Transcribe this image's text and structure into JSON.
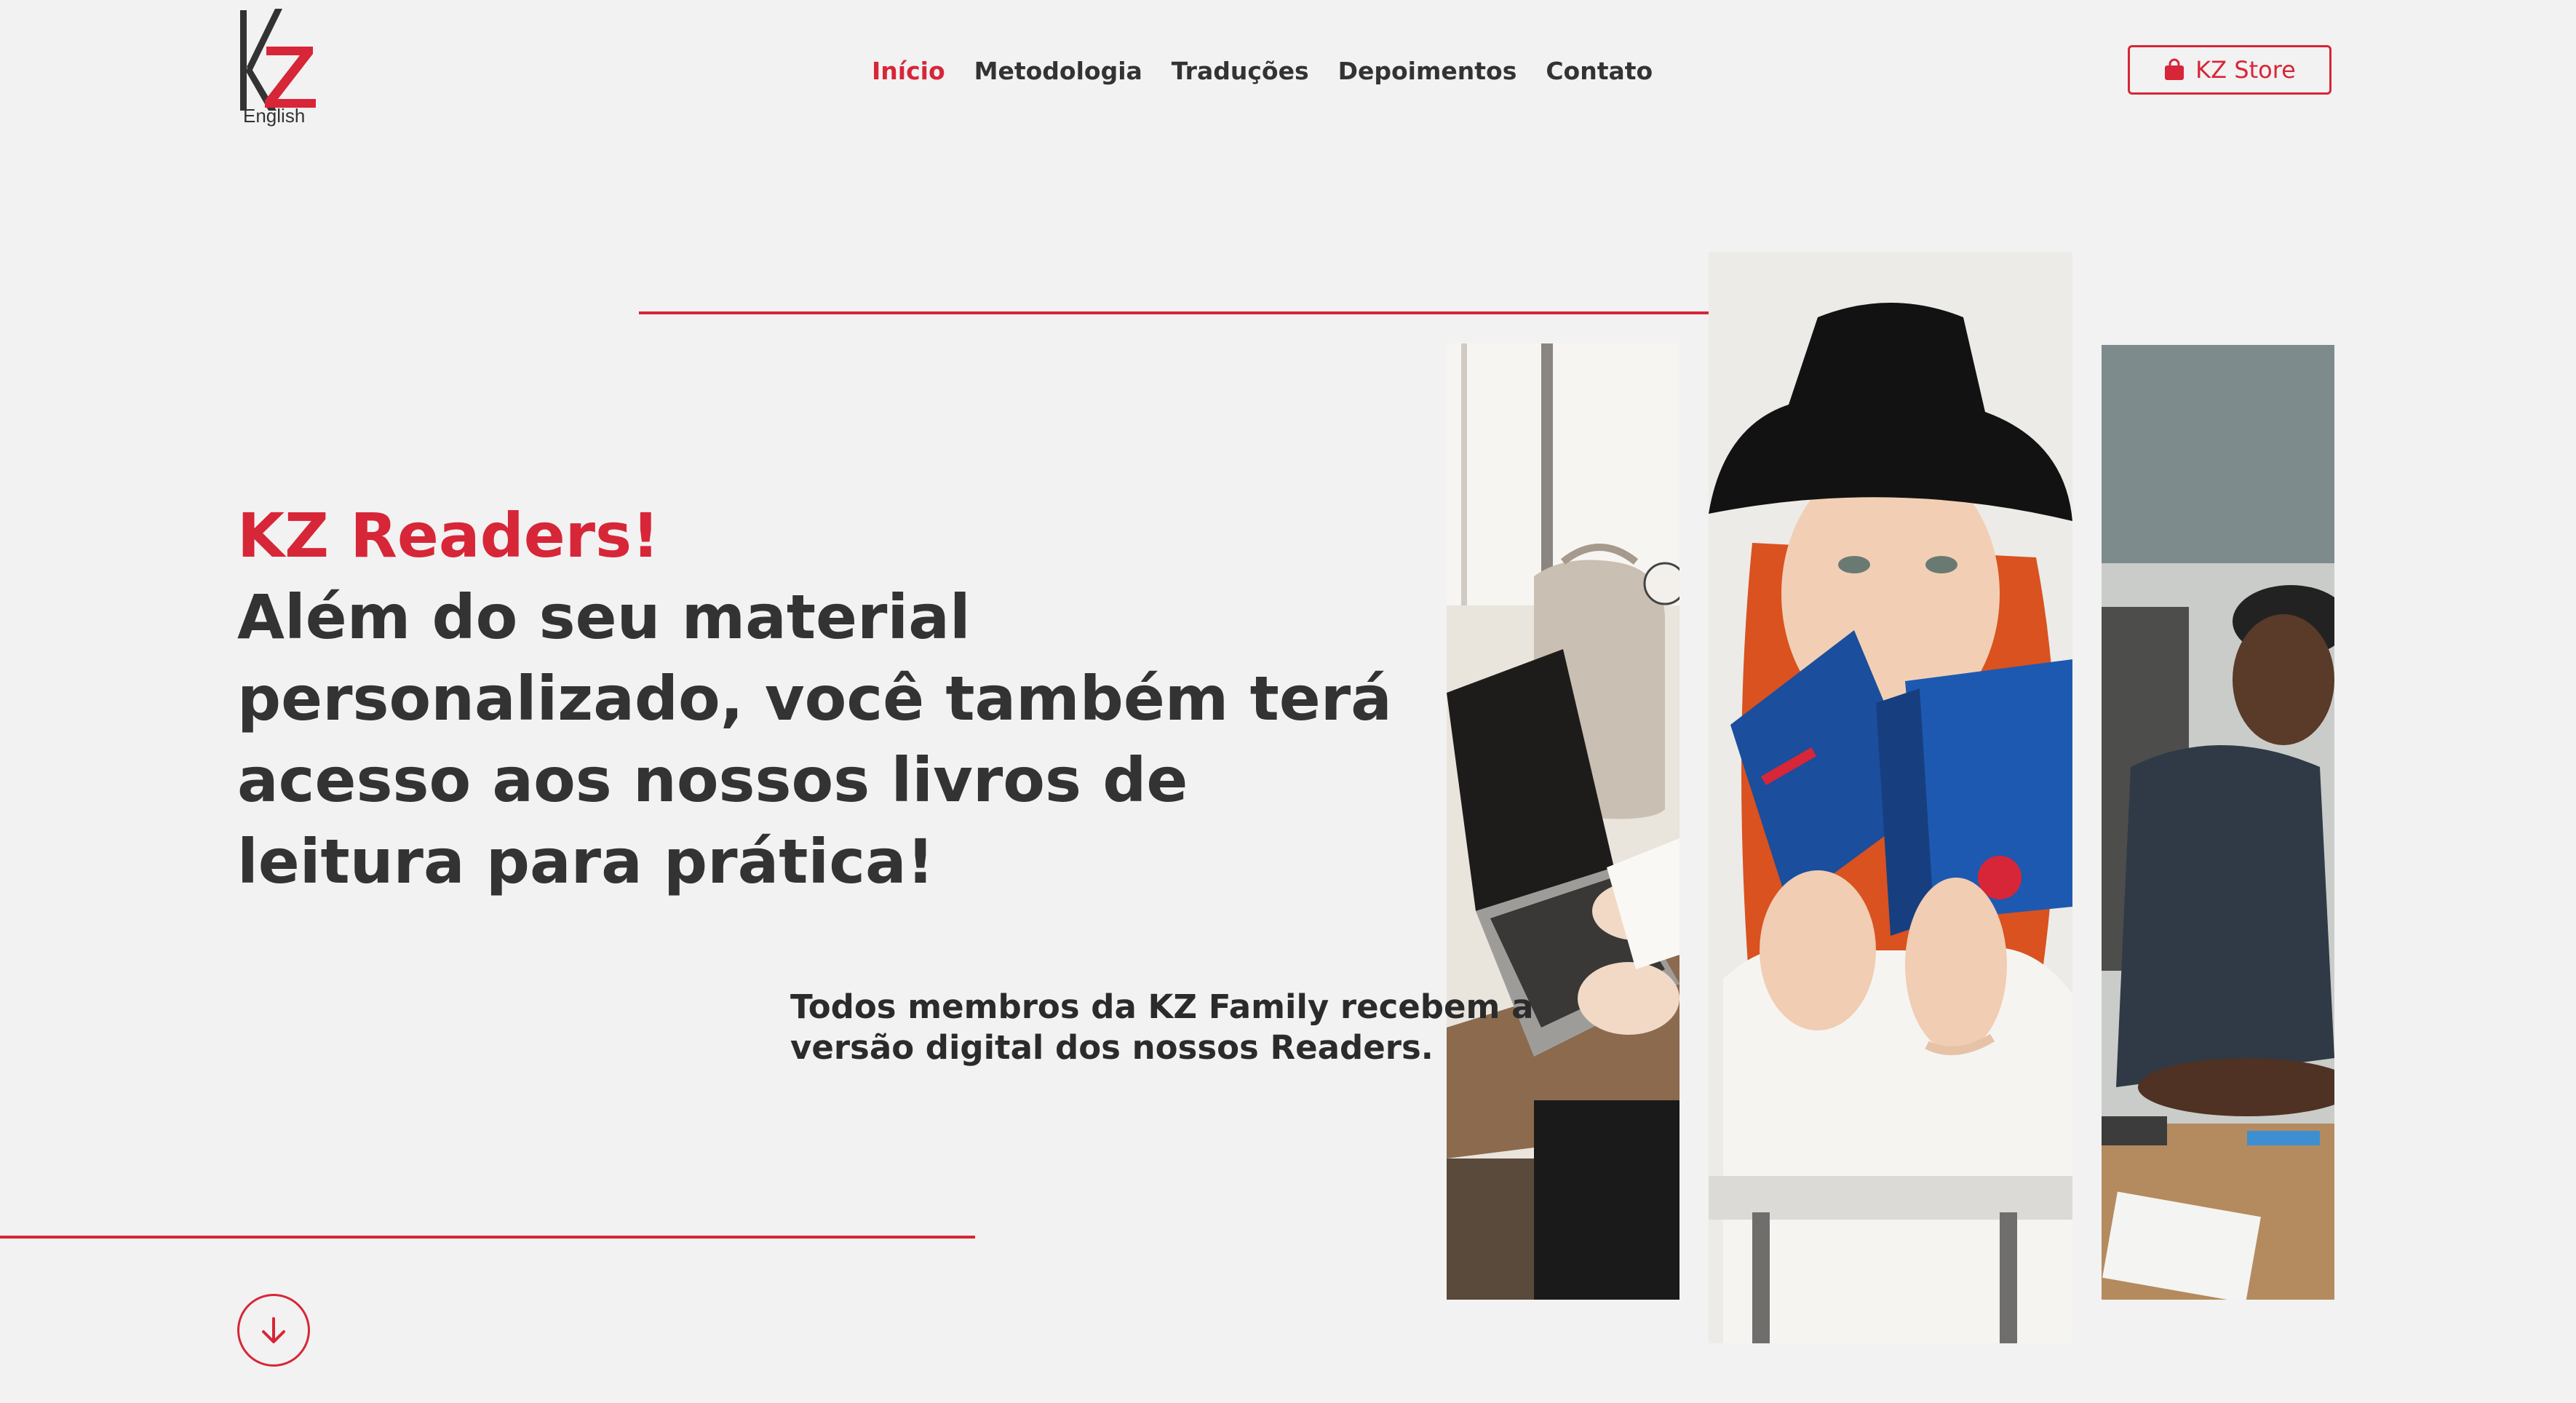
{
  "brand": {
    "logo_letters": "KZ",
    "logo_sub": "English",
    "accent_color": "#d72638",
    "text_color": "#333333",
    "background_color": "#f2f2f2"
  },
  "nav": {
    "items": [
      {
        "label": "Início",
        "active": true
      },
      {
        "label": "Metodologia",
        "active": false
      },
      {
        "label": "Traduções",
        "active": false
      },
      {
        "label": "Depoimentos",
        "active": false
      },
      {
        "label": "Contato",
        "active": false
      }
    ]
  },
  "store_button": {
    "label": "KZ Store",
    "icon": "shopping-bag-icon"
  },
  "hero": {
    "kicker": "KZ Readers!",
    "title": "Além do seu material\npersonalizado, você também terá\nacesso aos nossos livros de\nleitura para prática!",
    "subtitle": "Todos membros da KZ Family recebem a\nversão digital dos nossos Readers."
  },
  "photos": [
    {
      "description_icon": "laptop-photo"
    },
    {
      "description_icon": "woman-reading-dictionary-photo"
    },
    {
      "description_icon": "man-studying-photo"
    }
  ],
  "scroll_button": {
    "icon": "arrow-down-icon"
  }
}
